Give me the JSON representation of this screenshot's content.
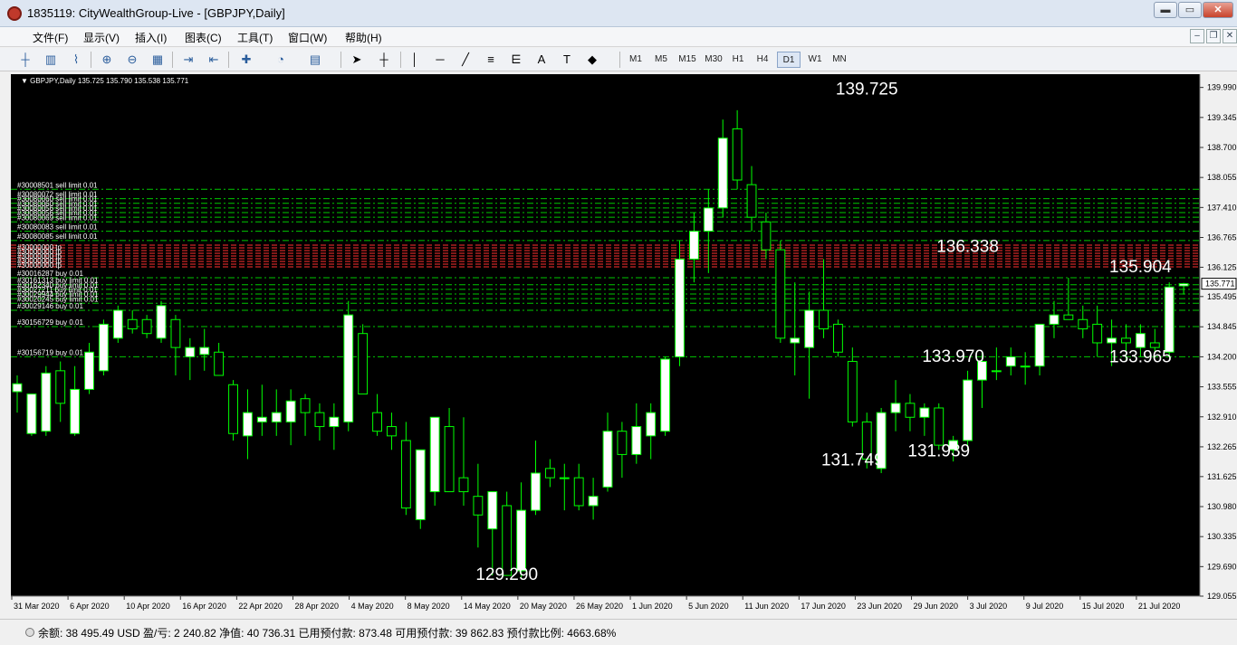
{
  "window": {
    "title": "1835119: CityWealthGroup-Live - [GBPJPY,Daily]",
    "min_label": "▬",
    "max_label": "▭",
    "close_label": "✕"
  },
  "menu": {
    "items": [
      "文件(F)",
      "显示(V)",
      "插入(I)",
      "图表(C)",
      "工具(T)",
      "窗口(W)",
      "帮助(H)"
    ],
    "mdi_min": "–",
    "mdi_restore": "❐",
    "mdi_close": "✕"
  },
  "toolbar": {
    "timeframes": [
      "M1",
      "M5",
      "M15",
      "M30",
      "H1",
      "H4",
      "D1",
      "W1",
      "MN"
    ],
    "active_timeframe": "D1",
    "icons": [
      "bar-chart-icon",
      "candle-chart-icon",
      "line-chart-icon",
      "zoom-in-icon",
      "zoom-out-icon",
      "tile-windows-icon",
      "auto-scroll-icon",
      "chart-shift-icon",
      "indicators-icon",
      "period-icon",
      "templates-icon",
      "cursor-icon",
      "crosshair-icon",
      "vertical-line-icon",
      "horizontal-line-icon",
      "trendline-icon",
      "fibonacci-icon",
      "fibo-fan-icon",
      "text-icon",
      "text-label-icon",
      "shapes-icon"
    ]
  },
  "chart": {
    "info": "GBPJPY,Daily  135.725 135.790 135.538 135.771",
    "current_price": "135.771",
    "background": "#000000",
    "bull_color": "#ffffff",
    "bear_color": "#000000",
    "wick_color": "#00ff00",
    "order_line_color": "#00c800",
    "tp_line_color": "#ff3030"
  },
  "chart_data": {
    "type": "candlestick",
    "symbol": "GBPJPY",
    "timeframe": "Daily",
    "ylim": [
      129.055,
      140.275
    ],
    "y_ticks": [
      139.99,
      139.345,
      138.7,
      138.055,
      137.41,
      136.765,
      136.125,
      135.495,
      134.845,
      134.2,
      133.555,
      132.91,
      132.265,
      131.625,
      130.98,
      130.335,
      129.69,
      129.055
    ],
    "x_labels": [
      "31 Mar 2020",
      "6 Apr 2020",
      "10 Apr 2020",
      "16 Apr 2020",
      "22 Apr 2020",
      "28 Apr 2020",
      "4 May 2020",
      "8 May 2020",
      "14 May 2020",
      "20 May 2020",
      "26 May 2020",
      "1 Jun 2020",
      "5 Jun 2020",
      "11 Jun 2020",
      "17 Jun 2020",
      "23 Jun 2020",
      "29 Jun 2020",
      "3 Jul 2020",
      "9 Jul 2020",
      "15 Jul 2020",
      "21 Jul 2020"
    ],
    "candles": [
      {
        "o": 133.45,
        "h": 133.8,
        "l": 133.0,
        "c": 133.62
      },
      {
        "o": 132.55,
        "h": 133.3,
        "l": 132.5,
        "c": 133.4
      },
      {
        "o": 132.6,
        "h": 134.0,
        "l": 132.5,
        "c": 133.85
      },
      {
        "o": 133.9,
        "h": 134.1,
        "l": 132.8,
        "c": 133.2
      },
      {
        "o": 132.55,
        "h": 134.0,
        "l": 132.5,
        "c": 133.5
      },
      {
        "o": 133.5,
        "h": 134.5,
        "l": 133.4,
        "c": 134.3
      },
      {
        "o": 133.9,
        "h": 135.0,
        "l": 133.8,
        "c": 134.9
      },
      {
        "o": 134.6,
        "h": 135.3,
        "l": 134.5,
        "c": 135.2
      },
      {
        "o": 135.0,
        "h": 135.2,
        "l": 134.7,
        "c": 134.8
      },
      {
        "o": 135.0,
        "h": 135.1,
        "l": 134.6,
        "c": 134.7
      },
      {
        "o": 134.6,
        "h": 135.4,
        "l": 134.5,
        "c": 135.3
      },
      {
        "o": 135.0,
        "h": 135.1,
        "l": 133.8,
        "c": 134.4
      },
      {
        "o": 134.2,
        "h": 134.6,
        "l": 133.7,
        "c": 134.4
      },
      {
        "o": 134.25,
        "h": 134.8,
        "l": 133.9,
        "c": 134.4
      },
      {
        "o": 134.3,
        "h": 134.5,
        "l": 133.8,
        "c": 133.8
      },
      {
        "o": 133.6,
        "h": 133.7,
        "l": 132.4,
        "c": 132.55
      },
      {
        "o": 132.5,
        "h": 133.5,
        "l": 132.0,
        "c": 133.0
      },
      {
        "o": 132.8,
        "h": 133.6,
        "l": 132.5,
        "c": 132.9
      },
      {
        "o": 132.8,
        "h": 133.5,
        "l": 132.5,
        "c": 133.0
      },
      {
        "o": 132.8,
        "h": 133.5,
        "l": 132.3,
        "c": 133.25
      },
      {
        "o": 133.3,
        "h": 133.4,
        "l": 132.5,
        "c": 133.0
      },
      {
        "o": 133.0,
        "h": 133.2,
        "l": 132.4,
        "c": 132.7
      },
      {
        "o": 132.7,
        "h": 133.2,
        "l": 132.2,
        "c": 132.9
      },
      {
        "o": 132.8,
        "h": 135.4,
        "l": 132.6,
        "c": 135.1
      },
      {
        "o": 134.7,
        "h": 134.9,
        "l": 133.4,
        "c": 133.4
      },
      {
        "o": 133.0,
        "h": 133.4,
        "l": 132.5,
        "c": 132.6
      },
      {
        "o": 132.7,
        "h": 133.0,
        "l": 132.2,
        "c": 132.5
      },
      {
        "o": 132.4,
        "h": 132.8,
        "l": 130.8,
        "c": 130.95
      },
      {
        "o": 130.7,
        "h": 132.0,
        "l": 130.5,
        "c": 132.2
      },
      {
        "o": 131.3,
        "h": 132.9,
        "l": 131.0,
        "c": 132.9
      },
      {
        "o": 132.7,
        "h": 133.1,
        "l": 131.3,
        "c": 131.3
      },
      {
        "o": 131.6,
        "h": 132.9,
        "l": 131.0,
        "c": 131.3
      },
      {
        "o": 131.2,
        "h": 131.9,
        "l": 130.1,
        "c": 130.8
      },
      {
        "o": 130.5,
        "h": 131.0,
        "l": 129.5,
        "c": 131.3
      },
      {
        "o": 131.0,
        "h": 131.3,
        "l": 129.6,
        "c": 129.5
      },
      {
        "o": 129.6,
        "h": 131.5,
        "l": 129.45,
        "c": 130.9
      },
      {
        "o": 130.9,
        "h": 132.4,
        "l": 130.8,
        "c": 131.7
      },
      {
        "o": 131.8,
        "h": 132.0,
        "l": 131.4,
        "c": 131.6
      },
      {
        "o": 131.6,
        "h": 131.9,
        "l": 130.9,
        "c": 131.6
      },
      {
        "o": 131.6,
        "h": 131.9,
        "l": 130.9,
        "c": 131.0
      },
      {
        "o": 131.0,
        "h": 131.6,
        "l": 130.7,
        "c": 131.2
      },
      {
        "o": 131.4,
        "h": 133.0,
        "l": 131.3,
        "c": 132.6
      },
      {
        "o": 132.6,
        "h": 132.8,
        "l": 131.6,
        "c": 132.1
      },
      {
        "o": 132.1,
        "h": 133.2,
        "l": 131.9,
        "c": 132.7
      },
      {
        "o": 132.5,
        "h": 133.2,
        "l": 132.0,
        "c": 133.0
      },
      {
        "o": 132.6,
        "h": 134.2,
        "l": 132.5,
        "c": 134.15
      },
      {
        "o": 134.2,
        "h": 136.7,
        "l": 134.0,
        "c": 136.3
      },
      {
        "o": 136.3,
        "h": 137.3,
        "l": 135.8,
        "c": 136.9
      },
      {
        "o": 136.9,
        "h": 137.8,
        "l": 136.0,
        "c": 137.4
      },
      {
        "o": 137.4,
        "h": 139.3,
        "l": 137.2,
        "c": 138.9
      },
      {
        "o": 139.1,
        "h": 139.5,
        "l": 137.8,
        "c": 138.0
      },
      {
        "o": 137.9,
        "h": 138.3,
        "l": 136.9,
        "c": 137.2
      },
      {
        "o": 137.1,
        "h": 137.3,
        "l": 136.3,
        "c": 136.5
      },
      {
        "o": 136.5,
        "h": 136.7,
        "l": 134.5,
        "c": 134.6
      },
      {
        "o": 134.5,
        "h": 135.8,
        "l": 133.8,
        "c": 134.6
      },
      {
        "o": 134.4,
        "h": 135.6,
        "l": 133.3,
        "c": 135.2
      },
      {
        "o": 135.2,
        "h": 136.3,
        "l": 134.6,
        "c": 134.8
      },
      {
        "o": 134.9,
        "h": 135.0,
        "l": 134.2,
        "c": 134.3
      },
      {
        "o": 134.1,
        "h": 134.4,
        "l": 132.7,
        "c": 132.8
      },
      {
        "o": 132.8,
        "h": 133.0,
        "l": 131.8,
        "c": 132.0
      },
      {
        "o": 131.8,
        "h": 133.1,
        "l": 131.7,
        "c": 133.0
      },
      {
        "o": 133.0,
        "h": 133.7,
        "l": 132.6,
        "c": 133.2
      },
      {
        "o": 133.2,
        "h": 133.4,
        "l": 132.6,
        "c": 132.9
      },
      {
        "o": 132.9,
        "h": 133.2,
        "l": 132.5,
        "c": 133.1
      },
      {
        "o": 133.1,
        "h": 133.2,
        "l": 132.2,
        "c": 132.3
      },
      {
        "o": 132.2,
        "h": 132.5,
        "l": 131.95,
        "c": 132.4
      },
      {
        "o": 132.4,
        "h": 133.9,
        "l": 132.2,
        "c": 133.7
      },
      {
        "o": 133.7,
        "h": 134.3,
        "l": 133.1,
        "c": 134.1
      },
      {
        "o": 133.9,
        "h": 134.4,
        "l": 133.7,
        "c": 133.9
      },
      {
        "o": 134.0,
        "h": 134.4,
        "l": 133.8,
        "c": 134.2
      },
      {
        "o": 134.0,
        "h": 134.3,
        "l": 133.6,
        "c": 134.0
      },
      {
        "o": 134.0,
        "h": 134.9,
        "l": 133.8,
        "c": 134.9
      },
      {
        "o": 134.9,
        "h": 135.4,
        "l": 134.6,
        "c": 135.1
      },
      {
        "o": 135.1,
        "h": 135.9,
        "l": 135.0,
        "c": 135.0
      },
      {
        "o": 135.0,
        "h": 135.3,
        "l": 134.6,
        "c": 134.8
      },
      {
        "o": 134.9,
        "h": 135.3,
        "l": 134.2,
        "c": 134.5
      },
      {
        "o": 134.5,
        "h": 135.0,
        "l": 134.0,
        "c": 134.6
      },
      {
        "o": 134.6,
        "h": 134.9,
        "l": 134.1,
        "c": 134.5
      },
      {
        "o": 134.4,
        "h": 134.9,
        "l": 134.2,
        "c": 134.7
      },
      {
        "o": 134.5,
        "h": 134.8,
        "l": 134.3,
        "c": 134.4
      },
      {
        "o": 134.3,
        "h": 135.8,
        "l": 134.2,
        "c": 135.7
      },
      {
        "o": 135.725,
        "h": 135.79,
        "l": 135.538,
        "c": 135.771
      }
    ],
    "annotations": [
      {
        "text": "139.725",
        "x": 59,
        "y": 139.725
      },
      {
        "text": "136.338",
        "x": 66,
        "y": 136.338
      },
      {
        "text": "135.904",
        "x": 78,
        "y": 135.904
      },
      {
        "text": "133.970",
        "x": 65,
        "y": 133.97
      },
      {
        "text": "133.965",
        "x": 78,
        "y": 133.965
      },
      {
        "text": "131.749",
        "x": 58,
        "y": 131.749
      },
      {
        "text": "131.939",
        "x": 64,
        "y": 131.939
      },
      {
        "text": "129.290",
        "x": 34,
        "y": 129.29
      }
    ],
    "orders": [
      {
        "label": "#30008501 sell limit 0.01",
        "price": 137.8
      },
      {
        "label": "#30080072 sell limit 0.01",
        "price": 137.6
      },
      {
        "label": "#30080060 sell limit 0.01",
        "price": 137.5
      },
      {
        "label": "#30080060 sell limit 0.01",
        "price": 137.4
      },
      {
        "label": "#30080056 sell limit 0.01",
        "price": 137.3
      },
      {
        "label": "#30080056 sell limit 0.01",
        "price": 137.2
      },
      {
        "label": "#30080069 sell limit 0.01",
        "price": 137.1
      },
      {
        "label": "#30080083 sell limit 0.01",
        "price": 136.9
      },
      {
        "label": "#30080085 sell limit 0.01",
        "price": 136.7
      },
      {
        "label": "#30016287 buy 0.01",
        "price": 135.9
      },
      {
        "label": "#30161313 buy limit 0.01",
        "price": 135.75
      },
      {
        "label": "#30162340 buy limit 0.01",
        "price": 135.65
      },
      {
        "label": "#30027211 buy limit 0.01",
        "price": 135.55
      },
      {
        "label": "#30029944 buy limit 0.01",
        "price": 135.45
      },
      {
        "label": "#30020245 buy limit 0.01",
        "price": 135.35
      },
      {
        "label": "#30029146 buy 0.01",
        "price": 135.2
      },
      {
        "label": "#30156729 buy 0.01",
        "price": 134.85
      },
      {
        "label": "#30156719 buy 0.01",
        "price": 134.2
      }
    ],
    "tp_label": "#30000000 tp",
    "tp_range": [
      136.1,
      136.6
    ]
  },
  "status": {
    "text": "余额: 38 495.49 USD   盈/亏: 2 240.82   净值: 40 736.31   已用预付款: 873.48   可用预付款: 39 862.83   预付款比例: 4663.68%"
  }
}
